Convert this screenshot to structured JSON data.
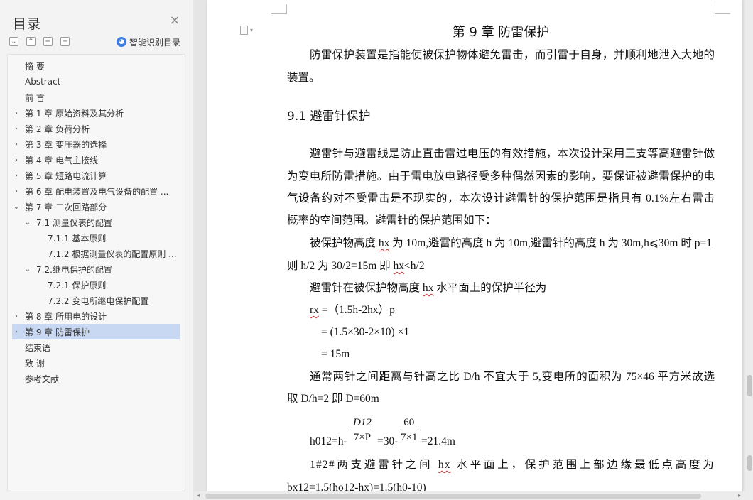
{
  "sidebar": {
    "title": "目录",
    "close_glyph": "×",
    "tools": [
      "⌄",
      "⌃",
      "+",
      "−"
    ],
    "smart_toc_label": "智能识别目录",
    "items": [
      {
        "label": "摘    要",
        "level": 0,
        "arrow": ""
      },
      {
        "label": "Abstract",
        "level": 0,
        "arrow": ""
      },
      {
        "label": "前    言",
        "level": 0,
        "arrow": ""
      },
      {
        "label": "第 1 章  原始资料及其分析",
        "level": 0,
        "arrow": "›"
      },
      {
        "label": "第 2 章  负荷分析",
        "level": 0,
        "arrow": "›"
      },
      {
        "label": "第 3 章  变压器的选择",
        "level": 0,
        "arrow": "›"
      },
      {
        "label": "第 4 章  电气主接线",
        "level": 0,
        "arrow": "›"
      },
      {
        "label": "第 5 章  短路电流计算",
        "level": 0,
        "arrow": "›"
      },
      {
        "label": "第 6 章  配电装置及电气设备的配置 ...",
        "level": 0,
        "arrow": "›"
      },
      {
        "label": "第 7 章  二次回路部分",
        "level": 0,
        "arrow": "⌄"
      },
      {
        "label": "7.1 测量仪表的配置",
        "level": 1,
        "arrow": "⌄"
      },
      {
        "label": "7.1.1 基本原则",
        "level": 2,
        "arrow": ""
      },
      {
        "label": "7.1.2 根据测量仪表的配置原则 ...",
        "level": 2,
        "arrow": ""
      },
      {
        "label": "7.2.继电保护的配置",
        "level": 1,
        "arrow": "⌄"
      },
      {
        "label": "7.2.1 保护原则",
        "level": 2,
        "arrow": ""
      },
      {
        "label": "7.2.2  变电所继电保护配置",
        "level": 2,
        "arrow": ""
      },
      {
        "label": "第 8 章  所用电的设计",
        "level": 0,
        "arrow": "›"
      },
      {
        "label": "第 9 章  防雷保护",
        "level": 0,
        "arrow": "›",
        "selected": true
      },
      {
        "label": "结束语",
        "level": 0,
        "arrow": ""
      },
      {
        "label": "致    谢",
        "level": 0,
        "arrow": ""
      },
      {
        "label": "参考文献",
        "level": 0,
        "arrow": ""
      }
    ]
  },
  "document": {
    "chapter_title": "第 9 章  防雷保护",
    "intro_1": "防雷保护装置是指能使被保护物体避免雷击，而引雷于自身，并顺利地泄入大地的",
    "intro_2": "装置。",
    "section_heading": "9.1 避雷针保护",
    "p1_1": "避雷针与避雷线是防止直击雷过电压的有效措施，本次设计采用三支等高避雷针做",
    "p1_2": "为变电所防雷措施。由于雷电放电路径受多种偶然因素的影响，要保证被避雷保护的电",
    "p1_3": "气设备约对不受雷击是不现实的，本次设计避雷针的保护范围是指具有 0.1%左右雷击",
    "p1_4": "概率的空间范围。避雷针的保护范围如下：",
    "p2_1a": "被保护物高度 ",
    "p2_1w": "hx",
    "p2_1b": " 为 10m,避雷的高度 h 为 10m,避雷针的高度 h 为 30m,h⩽30m 时 p=1",
    "p2_2a": "则 h/2 为 30/2=15m 即 ",
    "p2_2w": "hx",
    "p2_2b": "<h/2",
    "p3a": "避雷针在被保护物高度 ",
    "p3w": "hx",
    "p3b": " 水平面上的保护半径为",
    "f1w": "rx",
    "f1b": " =（1.5h-2hx）p",
    "f2": "= (1.5×30-2×10)  ×1",
    "f3": "= 15m",
    "p4_1": "通常两针之间距离与针高之比 D/h 不宜大于 5,变电所的面积为 75×46 平方米故选",
    "p4_2": "取 D/h=2 即 D=60m",
    "eq_a": "h012=h-",
    "eq_frac1_num": "D12",
    "eq_frac1_den": "7×P",
    "eq_b": "=30-",
    "eq_frac2_num": "60",
    "eq_frac2_den": "7×1",
    "eq_c": "=21.4m",
    "p5a": "1#2#两支避雷针之间 ",
    "p5w": "hx",
    "p5b": " 水平面上，保护范围上部边缘最低点高度为",
    "p6": "bx12=1.5(ho12-hx)=1.5(h0-10)"
  }
}
